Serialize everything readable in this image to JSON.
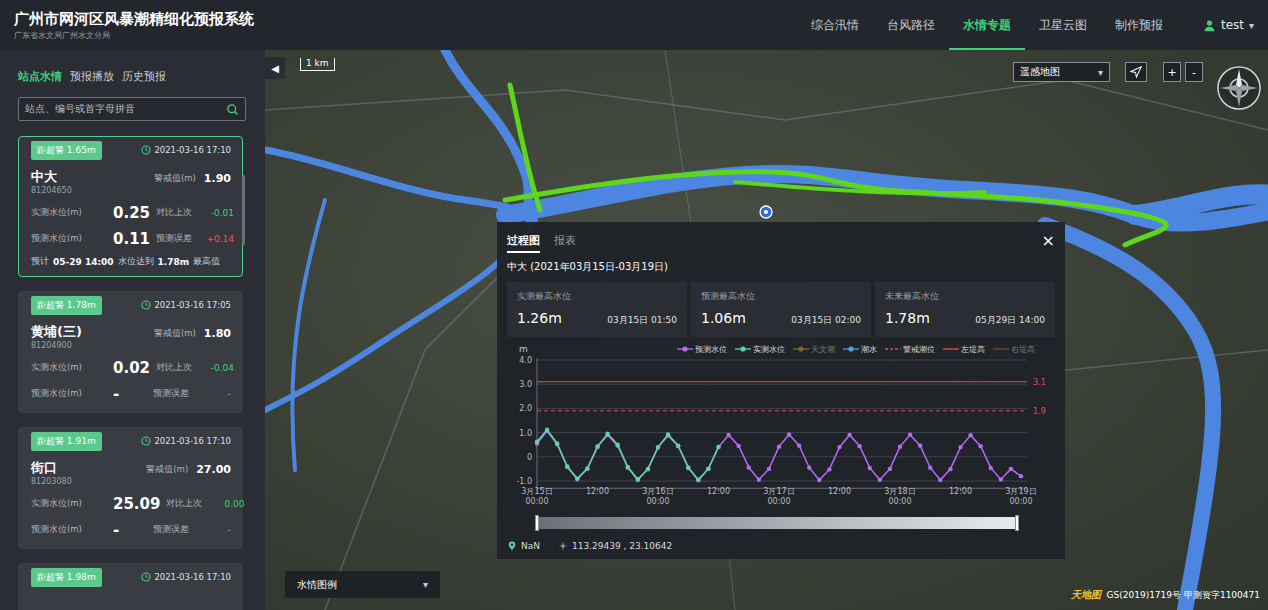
{
  "header": {
    "title": "广州市网河区风暴潮精细化预报系统",
    "subtitle": "广东省水文局广州水文分局",
    "nav": [
      {
        "label": "综合汛情",
        "selected": false
      },
      {
        "label": "台风路径",
        "selected": false
      },
      {
        "label": "水情专题",
        "selected": true
      },
      {
        "label": "卫星云图",
        "selected": false
      },
      {
        "label": "制作预报",
        "selected": false
      }
    ],
    "user": {
      "name": "test",
      "caret": "▾"
    }
  },
  "sidebar": {
    "tabs": [
      {
        "label": "站点水情",
        "selected": true
      },
      {
        "label": "预报播放",
        "selected": false
      },
      {
        "label": "历史预报",
        "selected": false
      }
    ],
    "search": {
      "placeholder": "站点、编号或首字母拼音"
    },
    "stations": [
      {
        "badge": "距超警 1.65m",
        "time": "2021-03-16 17:10",
        "name": "中大",
        "code": "81204650",
        "selected": true,
        "warning": {
          "label": "警戒值(m)",
          "value": "1.90"
        },
        "measured": {
          "label": "实测水位(m)",
          "value": "0.25"
        },
        "compare": {
          "label": "对比上次",
          "value": "-0.01",
          "color": "#3fcf6f"
        },
        "forecast": {
          "label": "预测水位(m)",
          "value": "0.11"
        },
        "error": {
          "label": "预测误差",
          "value": "+0.14",
          "color": "#ff4d4f"
        },
        "note": [
          {
            "text": "预计",
            "bold": false
          },
          {
            "text": "05-29 14:00",
            "bold": true
          },
          {
            "text": "水位达到",
            "bold": false
          },
          {
            "text": "1.78m",
            "bold": true
          },
          {
            "text": "最高值",
            "bold": false
          }
        ]
      },
      {
        "badge": "距超警 1.78m",
        "time": "2021-03-16 17:05",
        "name": "黄埔(三)",
        "code": "81204900",
        "selected": false,
        "warning": {
          "label": "警戒值(m)",
          "value": "1.80"
        },
        "measured": {
          "label": "实测水位(m)",
          "value": "0.02"
        },
        "compare": {
          "label": "对比上次",
          "value": "-0.04",
          "color": "#3fcf6f"
        },
        "forecast": {
          "label": "预测水位(m)",
          "value": "-"
        },
        "error": {
          "label": "预测误差",
          "value": "-",
          "color": "#9aa0a6"
        }
      },
      {
        "badge": "距超警 1.91m",
        "time": "2021-03-16 17:10",
        "name": "街口",
        "code": "81203080",
        "selected": false,
        "warning": {
          "label": "警戒值(m)",
          "value": "27.00"
        },
        "measured": {
          "label": "实测水位(m)",
          "value": "25.09"
        },
        "compare": {
          "label": "对比上次",
          "value": "0.00",
          "color": "#3fcf6f"
        },
        "forecast": {
          "label": "预测水位(m)",
          "value": "-"
        },
        "error": {
          "label": "预测误差",
          "value": "-",
          "color": "#9aa0a6"
        }
      },
      {
        "badge": "距超警 1.98m",
        "time": "2021-03-16 17:10",
        "selected": false
      }
    ]
  },
  "map": {
    "collapse": "◀",
    "scale": "1 km",
    "layer_select": {
      "value": "遥感地图",
      "caret": "▾"
    },
    "zoom": [
      "+",
      "-"
    ],
    "legend_dropdown": {
      "label": "水情图例",
      "caret": "▾"
    },
    "copyright": {
      "logo": "天地图",
      "text": "GS(2019)1719号 甲测资字1100471"
    }
  },
  "popup": {
    "tabs": [
      {
        "label": "过程图",
        "selected": true
      },
      {
        "label": "报表",
        "selected": false
      }
    ],
    "close": "×",
    "subtitle": "中大 (2021年03月15日-03月19日)",
    "stats": [
      {
        "label": "实测最高水位",
        "value": "1.26m",
        "time": "03月15日 01:50"
      },
      {
        "label": "预测最高水位",
        "value": "1.06m",
        "time": "03月15日 02:00"
      },
      {
        "label": "未来最高水位",
        "value": "1.78m",
        "time": "05月29日 14:00"
      }
    ],
    "chart": {
      "unit": "m",
      "y_max": 4,
      "y_min": -1.3,
      "x_min": 0,
      "x_max": 96,
      "legend": [
        {
          "label": "预测水位",
          "kind": "dot",
          "color": "#b36cf2",
          "enabled": true
        },
        {
          "label": "实测水位",
          "kind": "dot",
          "color": "#5fd3a8",
          "enabled": true
        },
        {
          "label": "天文潮",
          "kind": "dot",
          "color": "#f0c23c",
          "enabled": false
        },
        {
          "label": "潮水",
          "kind": "dot",
          "color": "#4a9ff0",
          "enabled": true
        },
        {
          "label": "警戒潮位",
          "kind": "dashed",
          "color": "#e0504a",
          "enabled": true
        },
        {
          "label": "左堤高",
          "kind": "line",
          "color": "#e0504a",
          "enabled": true
        },
        {
          "label": "右堤高",
          "kind": "line",
          "color": "#e07a4a",
          "enabled": false
        }
      ],
      "y_ticks": [
        {
          "label": "4.0",
          "value": 4
        },
        {
          "label": "3.0",
          "value": 3
        },
        {
          "label": "2.0",
          "value": 2
        },
        {
          "label": "1.0",
          "value": 1
        },
        {
          "label": "0",
          "value": 0
        },
        {
          "label": "-1.0",
          "value": -1
        }
      ],
      "thresholds": [
        {
          "label": "3.1",
          "value": 3.1,
          "color": "#e0504a",
          "dashed": false
        },
        {
          "label": "1.9",
          "value": 1.9,
          "color": "#e0504a",
          "dashed": true
        }
      ],
      "x_ticks": [
        {
          "hours": 0,
          "lines": [
            "3月15日",
            "00:00"
          ]
        },
        {
          "hours": 12,
          "lines": [
            "12:00"
          ]
        },
        {
          "hours": 24,
          "lines": [
            "3月16日",
            "00:00"
          ]
        },
        {
          "hours": 36,
          "lines": [
            "12:00"
          ]
        },
        {
          "hours": 48,
          "lines": [
            "3月17日",
            "00:00"
          ]
        },
        {
          "hours": 60,
          "lines": [
            "12:00"
          ]
        },
        {
          "hours": 72,
          "lines": [
            "3月18日",
            "00:00"
          ]
        },
        {
          "hours": 84,
          "lines": [
            "12:00"
          ]
        },
        {
          "hours": 96,
          "lines": [
            "3月19日",
            "00:00"
          ]
        }
      ],
      "series": [
        {
          "name": "预测水位",
          "color": "#b36cf2",
          "start_hours": 0,
          "step_hours": 2,
          "values": [
            0.55,
            1.06,
            0.52,
            -0.42,
            -0.93,
            -0.5,
            0.4,
            0.9,
            0.46,
            -0.45,
            -0.96,
            -0.52,
            0.38,
            0.88,
            0.44,
            -0.46,
            -0.97,
            -0.5,
            0.4,
            0.9,
            0.45,
            -0.44,
            -0.95,
            -0.5,
            0.42,
            0.92,
            0.46,
            -0.45,
            -0.96,
            -0.52,
            0.4,
            0.9,
            0.44,
            -0.46,
            -0.95,
            -0.5,
            0.42,
            0.91,
            0.46,
            -0.45,
            -0.96,
            -0.51,
            0.4,
            0.89,
            0.44,
            -0.46,
            -0.94,
            -0.5,
            -0.8
          ]
        },
        {
          "name": "实测水位",
          "color": "#5fd3a8",
          "start_hours": 0,
          "step_hours": 2,
          "values": [
            0.62,
            1.12,
            0.55,
            -0.4,
            -0.9,
            -0.48,
            0.43,
            0.95,
            0.5,
            -0.42,
            -0.93,
            -0.5,
            0.4,
            0.92,
            0.46,
            -0.44,
            -0.95,
            -0.49,
            0.41
          ]
        }
      ],
      "slider": {
        "start": 0,
        "end": 1
      }
    },
    "footer": {
      "place": "NaN",
      "coords": "113.29439 , 23.10642"
    }
  }
}
